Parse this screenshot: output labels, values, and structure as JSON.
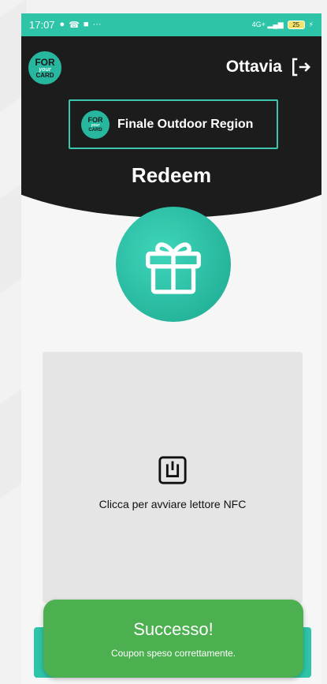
{
  "status_bar": {
    "time": "17:07",
    "left_icons": [
      "chat-icon",
      "phone-icon",
      "video-icon",
      "more-icon"
    ],
    "more": "···",
    "signal_text": "4G+",
    "battery": "25"
  },
  "header": {
    "logo": {
      "line1": "FOR",
      "line2": "your",
      "line3": "CARD"
    },
    "user_name": "Ottavia",
    "region_button": "Finale Outdoor Region"
  },
  "page": {
    "title": "Redeem"
  },
  "nfc": {
    "label": "Clicca per avviare lettore NFC"
  },
  "toast": {
    "title": "Successo!",
    "message": "Coupon speso correttamente."
  },
  "colors": {
    "accent": "#2ec4a8",
    "header_bg": "#1c1c1c",
    "success": "#4caf50",
    "nfc_bg": "#e5e5e5"
  }
}
